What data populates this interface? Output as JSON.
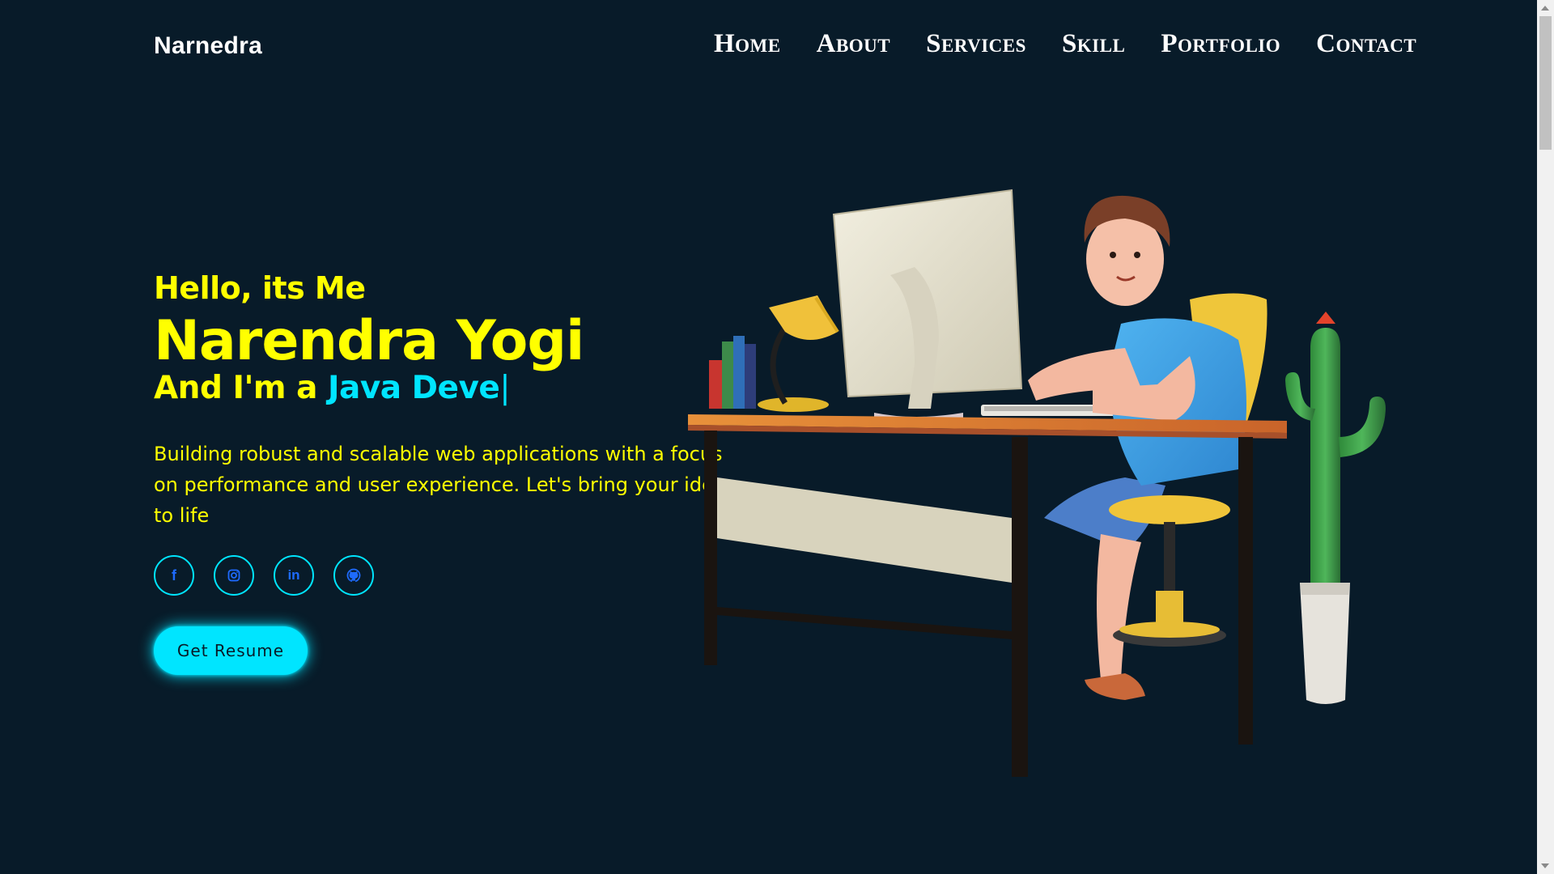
{
  "header": {
    "logo": "Narnedra",
    "nav": [
      {
        "label": "Home"
      },
      {
        "label": "About"
      },
      {
        "label": "Services"
      },
      {
        "label": "Skill"
      },
      {
        "label": "Portfolio"
      },
      {
        "label": "Contact"
      }
    ]
  },
  "hero": {
    "greeting": "Hello, its Me",
    "name": "Narendra Yogi",
    "role_prefix": "And I'm a ",
    "role_typed": "Java Deve",
    "cursor": "|",
    "description": "Building robust and scalable web applications with a focus on performance and user experience. Let's bring your ideas to life",
    "resume_label": "Get Resume"
  },
  "social": [
    {
      "name": "facebook-icon",
      "glyph": "f"
    },
    {
      "name": "instagram-icon",
      "glyph": ""
    },
    {
      "name": "linkedin-icon",
      "glyph": "in"
    },
    {
      "name": "github-icon",
      "glyph": ""
    }
  ],
  "colors": {
    "background": "#081b29",
    "accent": "#00e5ff",
    "text_primary": "#ffff00",
    "icon": "#1e6bff"
  }
}
